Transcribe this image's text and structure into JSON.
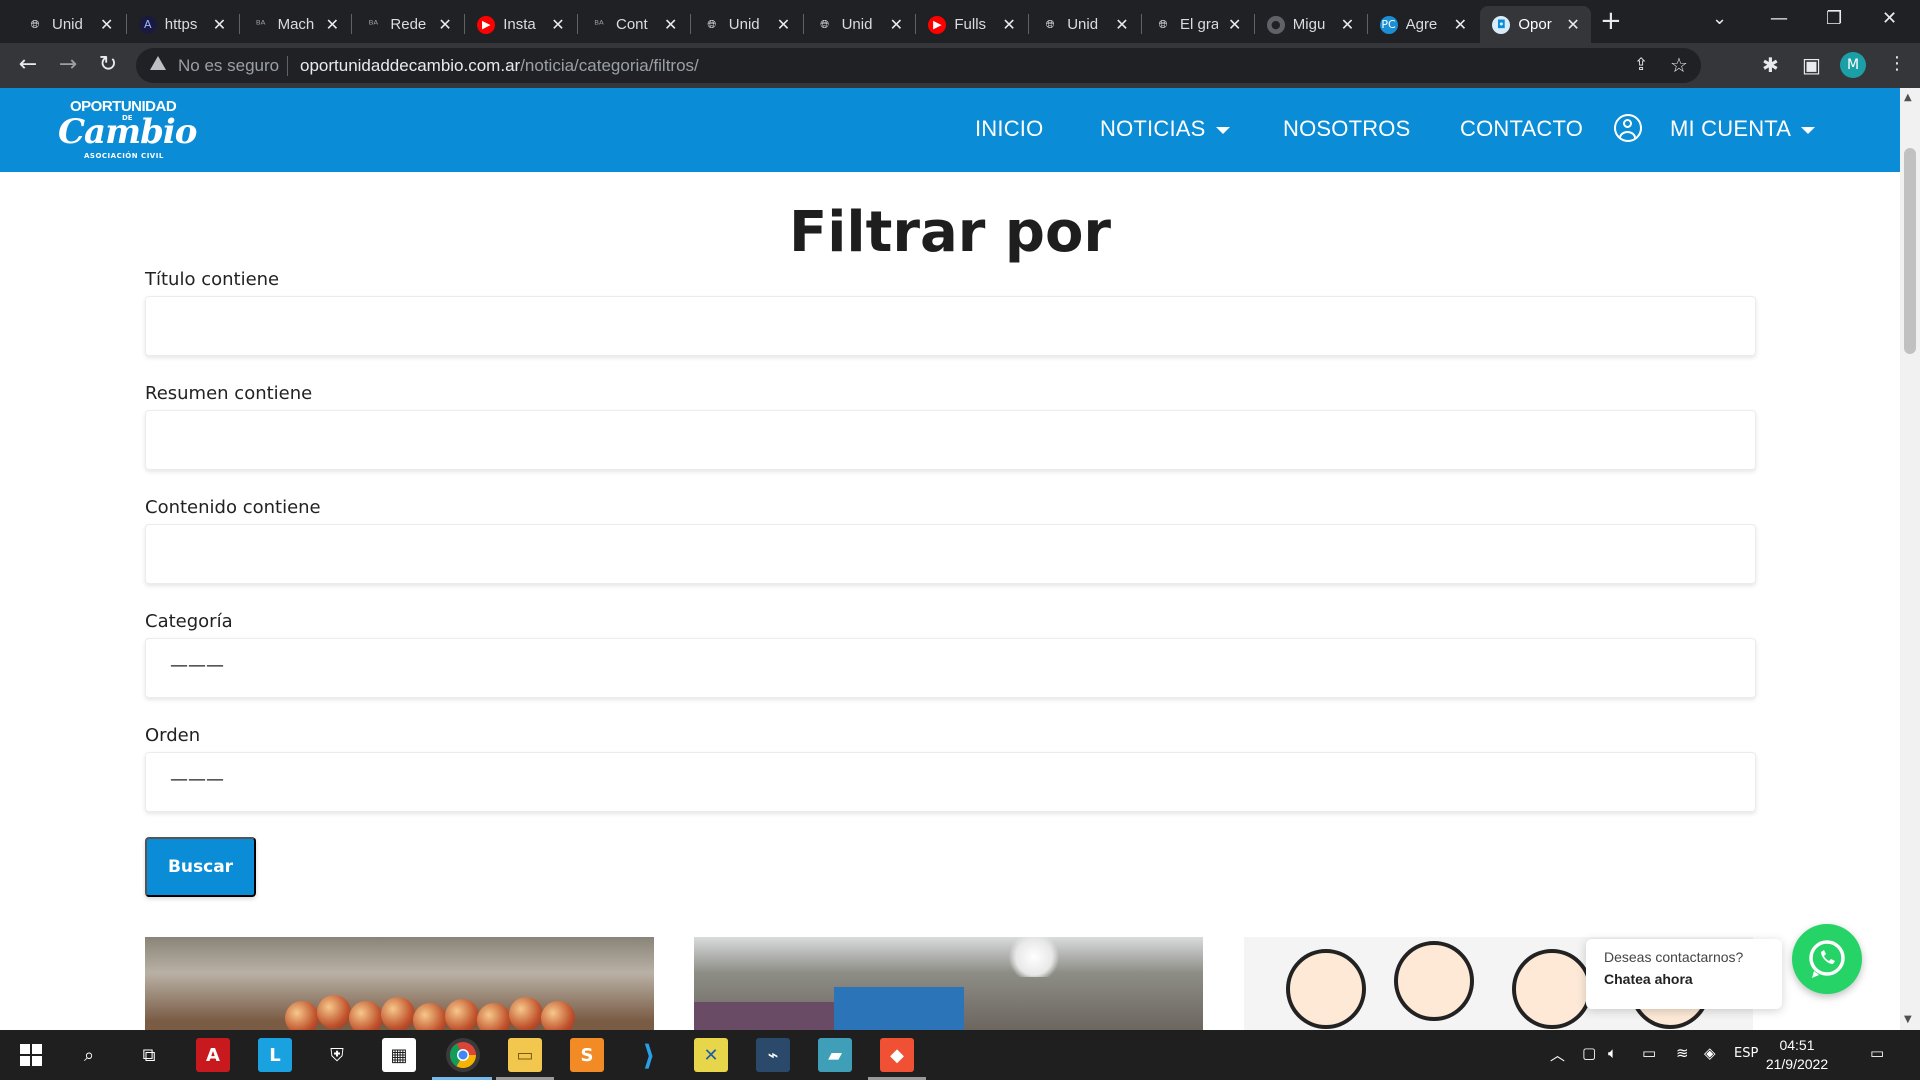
{
  "browser": {
    "tabs": [
      {
        "title": "Unid",
        "icon": "globe-icon"
      },
      {
        "title": "https",
        "icon": "arc-icon"
      },
      {
        "title": "Mach",
        "icon": "ba-icon"
      },
      {
        "title": "Rede",
        "icon": "ba-icon"
      },
      {
        "title": "Insta",
        "icon": "youtube-icon"
      },
      {
        "title": "Cont",
        "icon": "ba-icon"
      },
      {
        "title": "Unid",
        "icon": "globe-icon"
      },
      {
        "title": "Unid",
        "icon": "globe-icon"
      },
      {
        "title": "Fulls",
        "icon": "youtube-icon"
      },
      {
        "title": "Unid",
        "icon": "globe-icon"
      },
      {
        "title": "El gra",
        "icon": "globe-icon"
      },
      {
        "title": "Migu",
        "icon": "github-icon"
      },
      {
        "title": "Agre",
        "icon": "pc-icon"
      },
      {
        "title": "Opor",
        "icon": "site-icon",
        "active": true
      }
    ],
    "security_label": "No es seguro",
    "url_host": "oportunidaddecambio.com.ar",
    "url_path": "/noticia/categoria/filtros/",
    "profile_initial": "M"
  },
  "site": {
    "logo": {
      "line1": "OPORTUNIDAD",
      "line2": "DE",
      "line3": "Cambio",
      "line4": "ASOCIACIÓN CIVIL"
    },
    "nav": {
      "inicio": "INICIO",
      "noticias": "NOTICIAS",
      "nosotros": "NOSOTROS",
      "contacto": "CONTACTO",
      "cuenta": "MI CUENTA"
    },
    "brand_color": "#0b8cd6"
  },
  "form": {
    "title": "Filtrar por",
    "titulo_label": "Título contiene",
    "titulo_value": "",
    "resumen_label": "Resumen contiene",
    "resumen_value": "",
    "contenido_label": "Contenido contiene",
    "contenido_value": "",
    "categoria_label": "Categoría",
    "categoria_value": "———",
    "orden_label": "Orden",
    "orden_value": "———",
    "submit_label": "Buscar"
  },
  "whatsapp": {
    "question": "Deseas contactarnos?",
    "cta": "Chatea ahora",
    "color": "#25d366"
  },
  "taskbar": {
    "language": "ESP",
    "time": "04:51",
    "date": "21/9/2022"
  }
}
